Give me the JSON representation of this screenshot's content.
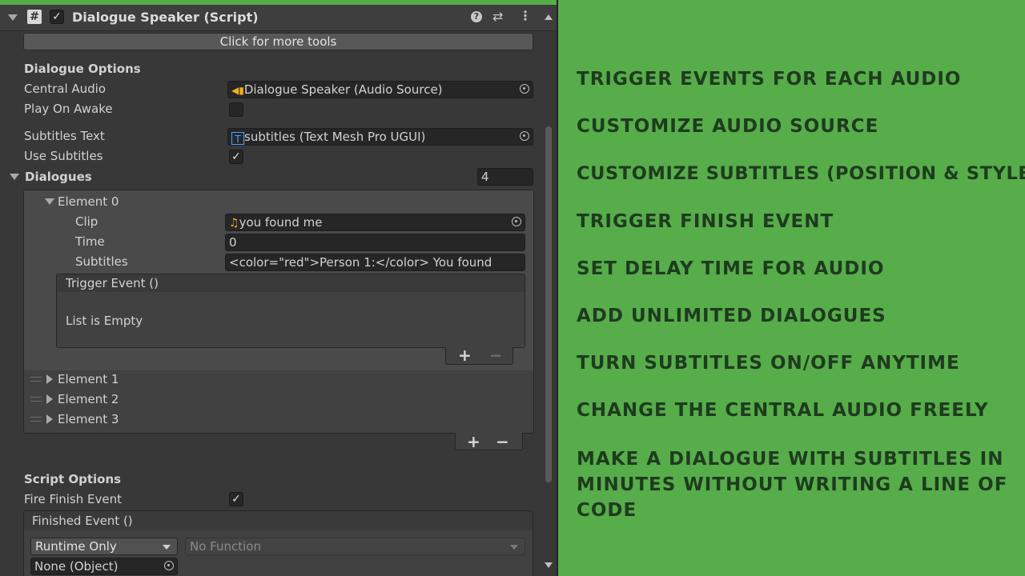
{
  "component": {
    "title": "Dialogue Speaker (Script)",
    "script_icon": "script-hash-icon",
    "more_tools_label": "Click for more tools"
  },
  "dialogue_options": {
    "heading": "Dialogue Options",
    "central_audio_label": "Central Audio",
    "central_audio_value": "Dialogue Speaker (Audio Source)",
    "play_on_awake_label": "Play On Awake",
    "play_on_awake_checked": false,
    "subtitles_text_label": "Subtitles Text",
    "subtitles_text_value": "subtitles (Text Mesh Pro UGUI)",
    "use_subtitles_label": "Use Subtitles",
    "use_subtitles_checked": true
  },
  "dialogues": {
    "label": "Dialogues",
    "count": "4",
    "element0": {
      "label": "Element 0",
      "clip_label": "Clip",
      "clip_value": "you found me",
      "time_label": "Time",
      "time_value": "0",
      "subtitles_label": "Subtitles",
      "subtitles_value": "<color=\"red\">Person 1:</color> You found",
      "trigger_event_label": "Trigger Event ()",
      "list_empty_label": "List is Empty"
    },
    "collapsed_elements": [
      "Element 1",
      "Element 2",
      "Element 3"
    ],
    "plus": "+",
    "minus": "−"
  },
  "script_options": {
    "heading": "Script Options",
    "fire_finish_event_label": "Fire Finish Event",
    "fire_finish_event_checked": true,
    "finished_event_label": "Finished Event ()",
    "runtime_dropdown": "Runtime Only",
    "function_dropdown": "No Function",
    "object_field": "None (Object)"
  },
  "features": [
    "TRIGGER EVENTS FOR EACH AUDIO",
    "CUSTOMIZE AUDIO SOURCE",
    "CUSTOMIZE SUBTITLES (POSITION & STYLE)",
    "TRIGGER FINISH EVENT",
    "SET DELAY TIME FOR AUDIO",
    "ADD UNLIMITED DIALOGUES",
    "TURN SUBTITLES ON/OFF ANYTIME",
    "CHANGE THE CENTRAL AUDIO FREELY",
    "MAKE A DIALOGUE WITH SUBTITLES IN",
    "MINUTES WITHOUT WRITING A LINE OF",
    "CODE"
  ],
  "colors": {
    "background_green": "#56ad4a",
    "feature_text": "#1f3b1f",
    "inspector_bg": "#383838"
  }
}
